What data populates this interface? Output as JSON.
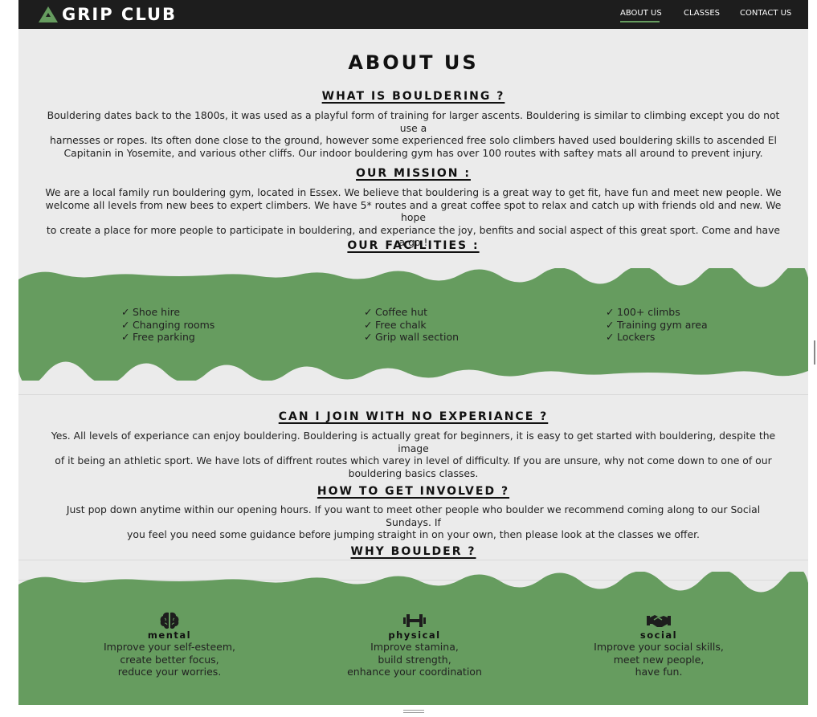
{
  "nav": {
    "brand": "GRIP CLUB",
    "links": [
      "ABOUT US",
      "CLASSES",
      "CONTACT US"
    ],
    "accent": "#669c5f"
  },
  "about": {
    "title": "ABOUT US",
    "what": {
      "heading": "What is bouldering ?",
      "lines": [
        "Bouldering dates back to the 1800s, it was used as a playful form of training for larger ascents. Bouldering is similar to climbing except you do not use a",
        "harnesses or ropes. Its often done close to the ground, however some experienced free solo climbers haved used bouldering skills to ascended El",
        "Capitanin in Yosemite, and various other cliffs. Our indoor bouldering gym has over 100 routes with saftey mats all around to prevent injury."
      ]
    },
    "mission": {
      "heading": "Our Mission :",
      "lines": [
        "We are a local family run bouldering gym, located in Essex. We believe that bouldering is a great way to get fit, have fun and meet new people. We",
        "welcome all levels from new bees to expert climbers. We have 5* routes and a great coffee spot to relax and catch up with friends old and new. We hope",
        "to create a place for more people to participate in bouldering, and experiance the joy, benfits and social aspect of this great sport. Come and have a go !"
      ]
    },
    "facilities": {
      "heading": "Our Facilities :",
      "columns": [
        [
          "Shoe hire",
          "Changing rooms",
          "Free parking"
        ],
        [
          "Coffee hut",
          "Free chalk",
          "Grip wall section"
        ],
        [
          "100+ climbs",
          "Training gym area",
          "Lockers"
        ]
      ]
    },
    "join": {
      "heading": "Can I join with no experiance ?",
      "lines": [
        "Yes. All levels of experiance can enjoy bouldering. Bouldering is actually great for beginners, it is easy to get started with bouldering, despite the image",
        "of it being an athletic sport. We have lots of diffrent routes which varey in level of difficulty. If you are unsure, why not come down to one of our",
        "bouldering basics classes."
      ]
    },
    "involved": {
      "heading": "How to get involved ?",
      "lines": [
        "Just pop down anytime within our opening hours. If you want to meet other people who boulder we recommend coming along to our Social Sundays. If",
        "you feel you need some guidance before jumping straight in on your own, then please look at the classes we offer."
      ]
    },
    "why": {
      "heading": "Why boulder ?",
      "columns": [
        {
          "icon": "brain-icon",
          "title": "mental",
          "lines": [
            "Improve your self-esteem,",
            "create better focus,",
            "reduce your worries."
          ]
        },
        {
          "icon": "dumbbell-icon",
          "title": "PHYSICAL",
          "lines": [
            "Improve stamina,",
            "build strength,",
            "enhance your coordination"
          ]
        },
        {
          "icon": "handshake-icon",
          "title": "SOCIAL",
          "lines": [
            "Improve your social skills,",
            "meet new people,",
            "have fun."
          ]
        }
      ]
    }
  },
  "colors": {
    "band": "#669c5f",
    "page": "#ebebeb",
    "nav": "#1d1d1d"
  }
}
